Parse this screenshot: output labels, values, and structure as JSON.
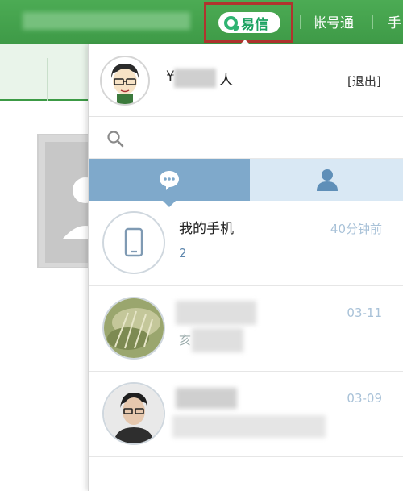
{
  "header": {
    "app_name": "易信",
    "links": [
      "帐号通",
      "手"
    ]
  },
  "user": {
    "name_visible_prefix": "¥",
    "name_visible_suffix": "人",
    "logout_label": "[退出]"
  },
  "search": {
    "placeholder": ""
  },
  "tabs": [
    "chat",
    "contacts"
  ],
  "conversations": [
    {
      "name": "我的手机",
      "preview": "2",
      "time": "40分钟前",
      "avatar": "phone-icon"
    },
    {
      "name": "",
      "preview": "亥",
      "time": "03-11",
      "avatar": "photo"
    },
    {
      "name": "",
      "preview": "",
      "time": "03-09",
      "avatar": "photo"
    }
  ],
  "colors": {
    "header_green": "#3e9a47",
    "yixin_green": "#1aa260",
    "highlight_red": "#b0342e",
    "tab_active": "#7fa9cb",
    "tab_inactive": "#d9e8f4",
    "time_color": "#a9c2d8"
  }
}
